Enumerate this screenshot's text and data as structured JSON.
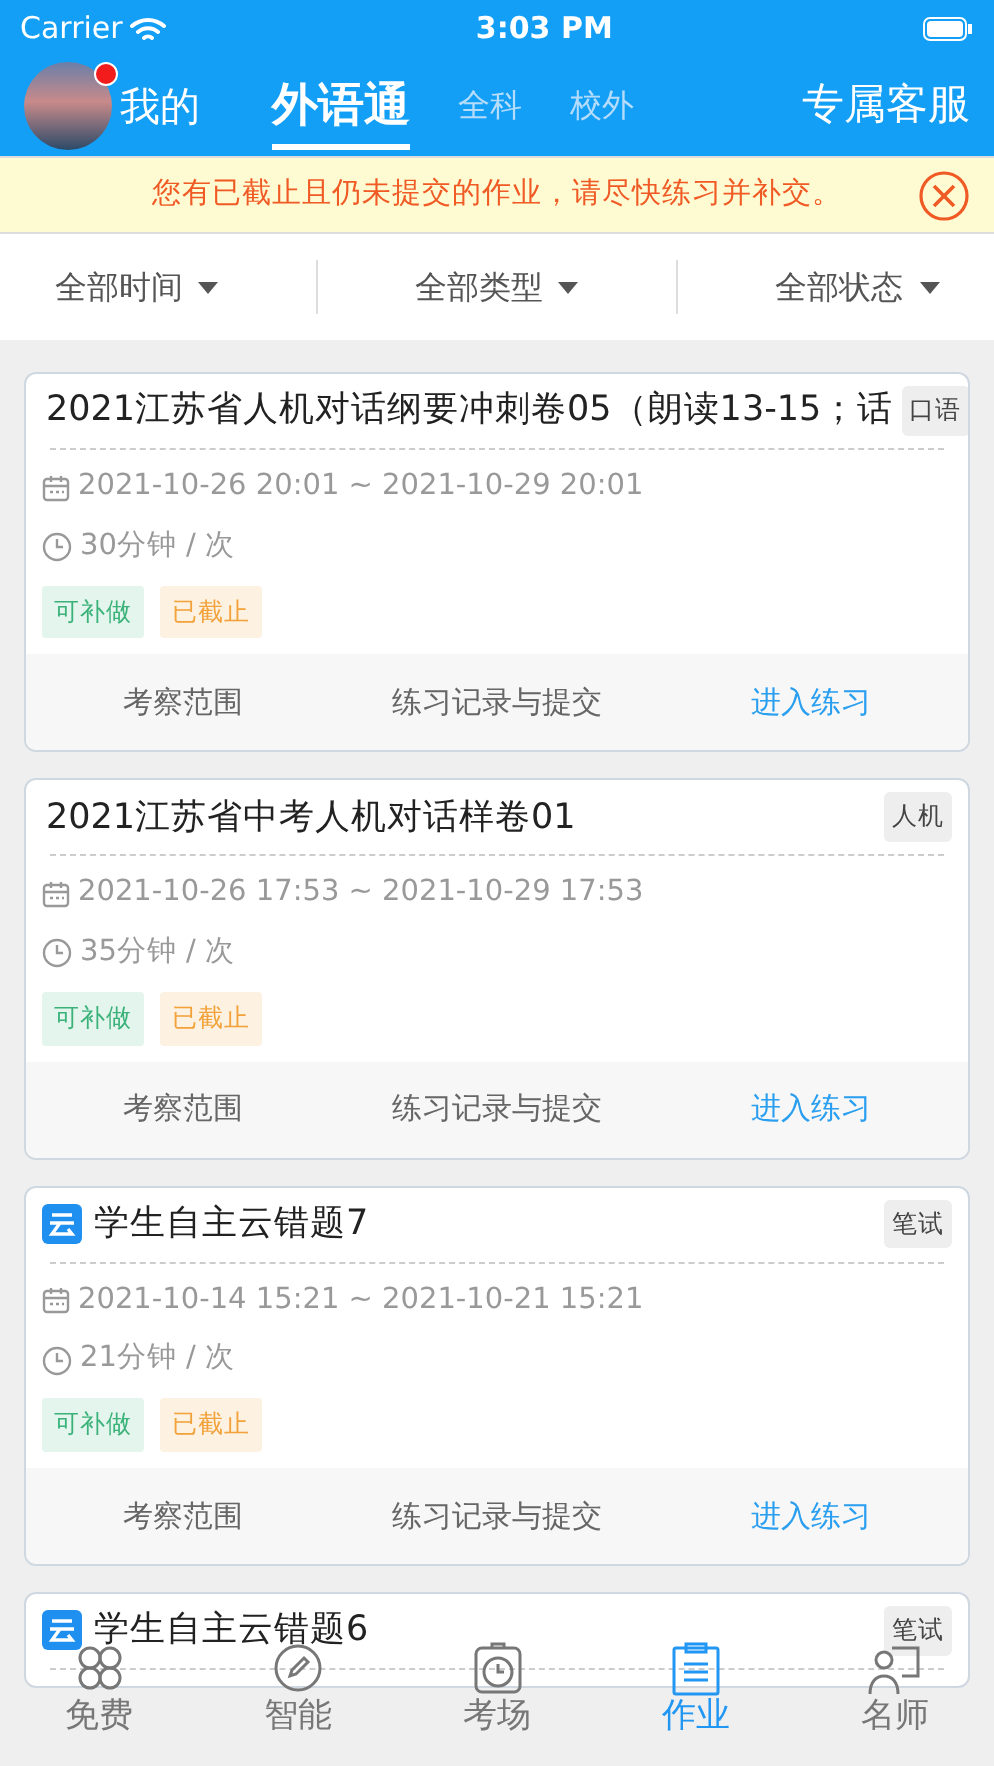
{
  "status_bar": {
    "carrier": "Carrier",
    "time": "3:03 PM"
  },
  "header": {
    "avatar_badge": true,
    "tabs": [
      {
        "label": "我的",
        "kind": "profile",
        "selected": false
      },
      {
        "label": "外语通",
        "kind": "main",
        "selected": true
      },
      {
        "label": "全科",
        "kind": "main",
        "selected": false
      },
      {
        "label": "校外",
        "kind": "main",
        "selected": false
      },
      {
        "label": "专属客服",
        "kind": "service",
        "selected": false
      }
    ]
  },
  "notice": {
    "text": "您有已截止且仍未提交的作业，请尽快练习并补交。"
  },
  "filters": [
    "全部时间",
    "全部类型",
    "全部状态"
  ],
  "cards": [
    {
      "title": "2021江苏省人机对话纲要冲刺卷05（朗读13-15；话",
      "cloud_icon": false,
      "type_tag": "口语",
      "date": "2021-10-26 20:01 ~ 2021-10-29 20:01",
      "duration": "30分钟 / 次",
      "tags": [
        {
          "text": "可补做",
          "kind": "makeup"
        },
        {
          "text": "已截止",
          "kind": "expired"
        }
      ],
      "actions": [
        {
          "text": "考察范围",
          "kind": "plain"
        },
        {
          "text": "练习记录与提交",
          "kind": "plain"
        },
        {
          "text": "进入练习",
          "kind": "primary"
        }
      ]
    },
    {
      "title": "2021江苏省中考人机对话样卷01",
      "cloud_icon": false,
      "type_tag": "人机",
      "date": "2021-10-26 17:53 ~ 2021-10-29 17:53",
      "duration": "35分钟 / 次",
      "tags": [
        {
          "text": "可补做",
          "kind": "makeup"
        },
        {
          "text": "已截止",
          "kind": "expired"
        }
      ],
      "actions": [
        {
          "text": "考察范围",
          "kind": "plain"
        },
        {
          "text": "练习记录与提交",
          "kind": "plain"
        },
        {
          "text": "进入练习",
          "kind": "primary"
        }
      ]
    },
    {
      "title": "学生自主云错题7",
      "cloud_icon": true,
      "type_tag": "笔试",
      "date": "2021-10-14 15:21 ~ 2021-10-21 15:21",
      "duration": "21分钟 / 次",
      "tags": [
        {
          "text": "可补做",
          "kind": "makeup"
        },
        {
          "text": "已截止",
          "kind": "expired"
        }
      ],
      "actions": [
        {
          "text": "考察范围",
          "kind": "plain"
        },
        {
          "text": "练习记录与提交",
          "kind": "plain"
        },
        {
          "text": "进入练习",
          "kind": "primary"
        }
      ]
    },
    {
      "title": "学生自主云错题6",
      "cloud_icon": true,
      "type_tag": "笔试"
    }
  ],
  "tab_bar": [
    {
      "label": "免费",
      "selected": false
    },
    {
      "label": "智能",
      "selected": false
    },
    {
      "label": "考场",
      "selected": false
    },
    {
      "label": "作业",
      "selected": true
    },
    {
      "label": "名师",
      "selected": false
    }
  ]
}
